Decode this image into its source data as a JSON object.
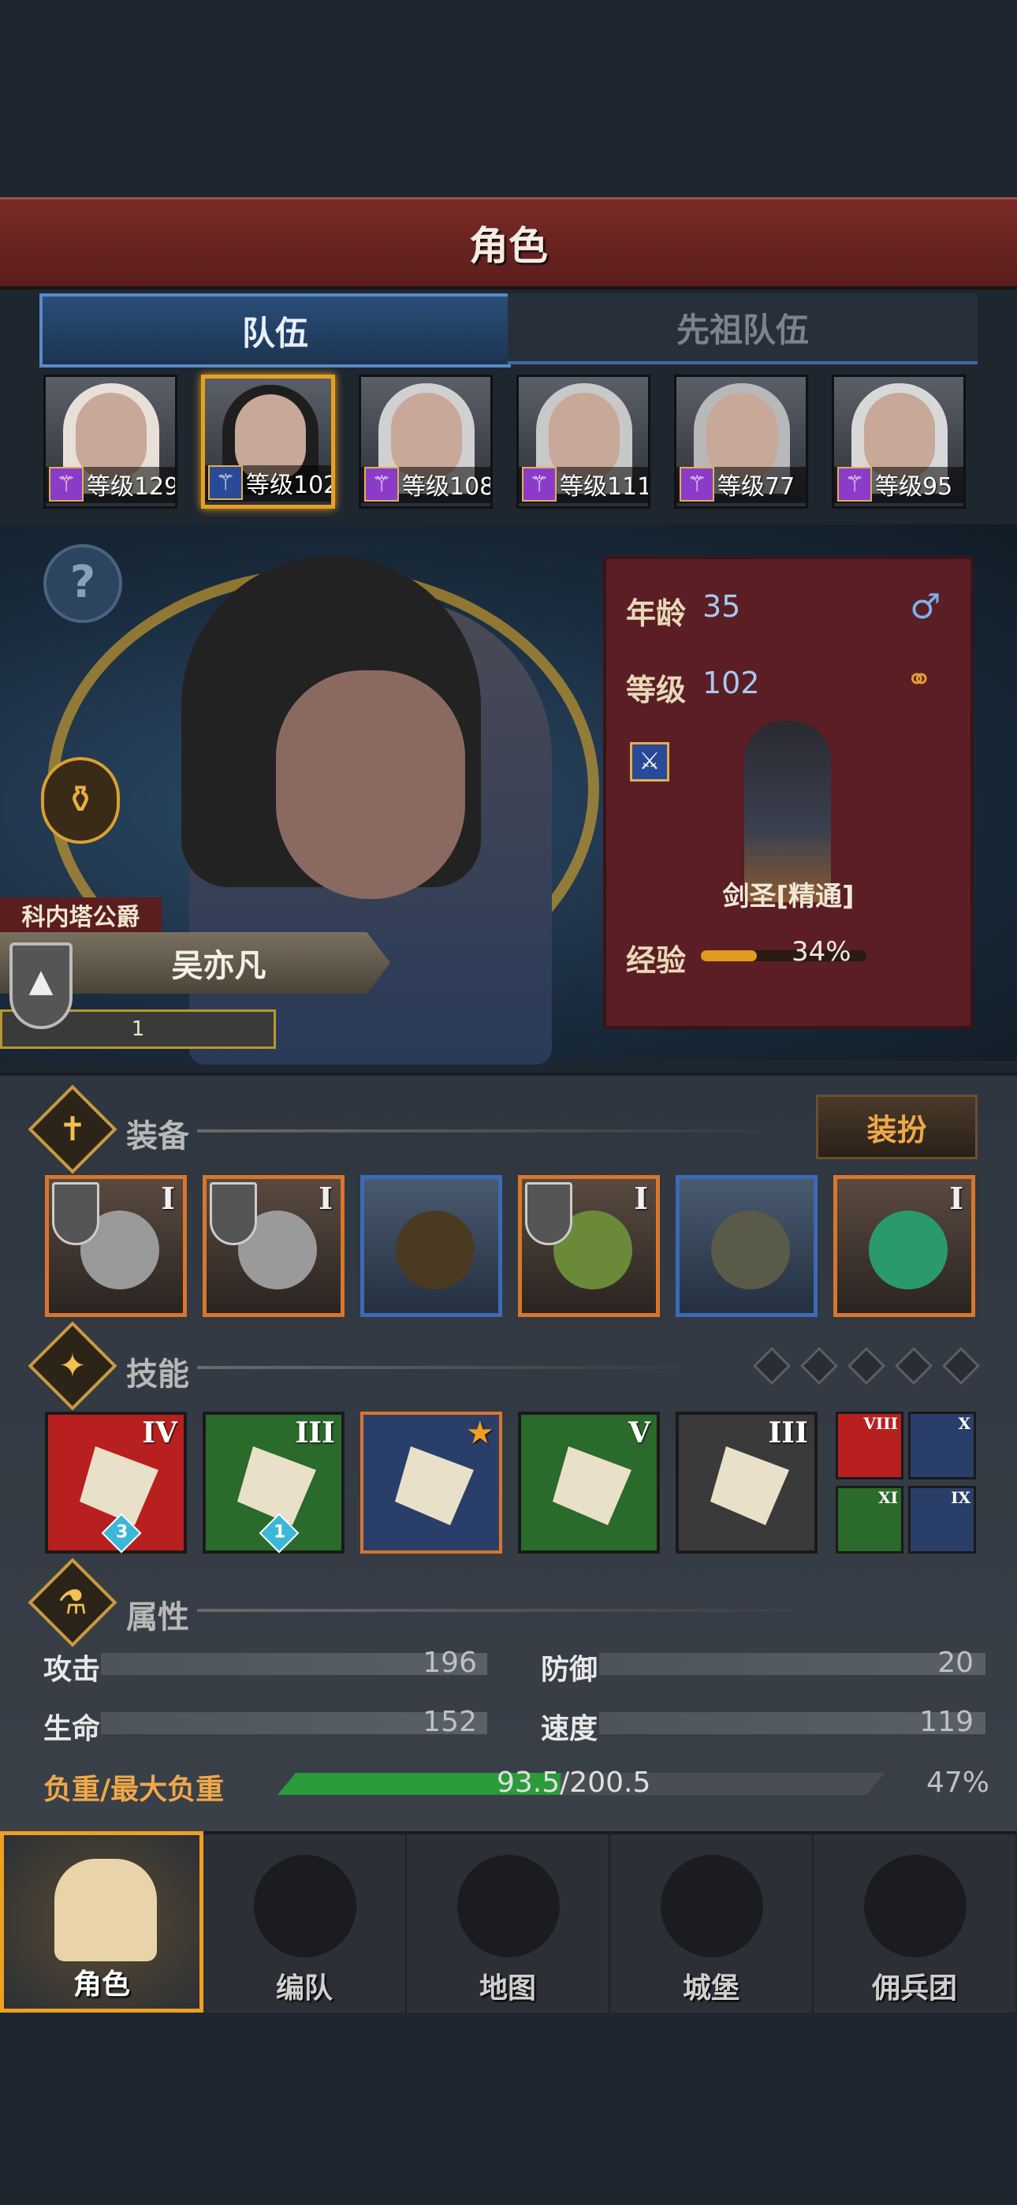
{
  "header": {
    "title": "角色"
  },
  "tabs": [
    {
      "label": "队伍",
      "active": true
    },
    {
      "label": "先祖队伍",
      "active": false
    }
  ],
  "party": [
    {
      "level_text": "等级129",
      "class_color": "#8a3cc8",
      "selected": false
    },
    {
      "level_text": "等级102",
      "class_color": "#2a4a98",
      "selected": true
    },
    {
      "level_text": "等级108",
      "class_color": "#8a3cc8",
      "selected": false
    },
    {
      "level_text": "等级111",
      "class_color": "#8a3cc8",
      "selected": false
    },
    {
      "level_text": "等级77",
      "class_color": "#8a3cc8",
      "selected": false
    },
    {
      "level_text": "等级95",
      "class_color": "#8a3cc8",
      "selected": false
    }
  ],
  "hero": {
    "title": "科内塔公爵",
    "name": "吴亦凡",
    "rank_value": "1"
  },
  "info": {
    "age_label": "年龄",
    "age_value": "35",
    "level_label": "等级",
    "level_value": "102",
    "class_name": "剑圣[精通]",
    "xp_label": "经验",
    "xp_percent_text": "34%",
    "xp_fraction": 0.34,
    "gender_icon": "male-symbol-icon",
    "ring_icon": "wedding-ring-icon"
  },
  "equipment": {
    "label": "装备",
    "dress_button": "装扮",
    "slots": [
      {
        "tier": "I",
        "rarity": "orange",
        "item": "axe",
        "has_shield": true
      },
      {
        "tier": "I",
        "rarity": "orange",
        "item": "axe",
        "has_shield": true
      },
      {
        "tier": "",
        "rarity": "blue",
        "item": "hood",
        "has_shield": false
      },
      {
        "tier": "I",
        "rarity": "orange",
        "item": "armor",
        "has_shield": true
      },
      {
        "tier": "",
        "rarity": "blue",
        "item": "boots",
        "has_shield": false
      },
      {
        "tier": "I",
        "rarity": "orange",
        "item": "ring",
        "has_shield": false
      }
    ]
  },
  "skills": {
    "label": "技能",
    "big": [
      {
        "tier": "IV",
        "color": "#b82020",
        "gem": "3"
      },
      {
        "tier": "III",
        "color": "#2a6a2a",
        "gem": "1"
      },
      {
        "tier": "",
        "color": "#2a3e6a",
        "gem": ""
      },
      {
        "tier": "V",
        "color": "#2a6a2a",
        "gem": ""
      },
      {
        "tier": "III",
        "color": "#3a3a3a",
        "gem": ""
      }
    ],
    "small": [
      {
        "tier": "VIII",
        "color": "#b82020"
      },
      {
        "tier": "X",
        "color": "#2a3e6a"
      },
      {
        "tier": "XI",
        "color": "#2a6a2a"
      },
      {
        "tier": "IX",
        "color": "#2a3e6a"
      }
    ]
  },
  "attributes": {
    "label": "属性",
    "attack_label": "攻击",
    "attack_value": "196",
    "defense_label": "防御",
    "defense_value": "20",
    "hp_label": "生命",
    "hp_value": "152",
    "speed_label": "速度",
    "speed_value": "119",
    "load_label": "负重/最大负重",
    "load_value": "93.5/200.5",
    "load_percent": "47%",
    "load_fraction": 0.466
  },
  "nav": [
    {
      "label": "角色",
      "icon": "knight-icon",
      "active": true
    },
    {
      "label": "编队",
      "icon": "helmet-icon",
      "active": false
    },
    {
      "label": "地图",
      "icon": "compass-map-icon",
      "active": false
    },
    {
      "label": "城堡",
      "icon": "castle-icon",
      "active": false
    },
    {
      "label": "佣兵团",
      "icon": "mercenary-banner-icon",
      "active": false
    }
  ],
  "colors": {
    "accent_gold": "#e8a020",
    "header_red": "#7a2a26",
    "tab_blue": "#2a4e7a"
  }
}
